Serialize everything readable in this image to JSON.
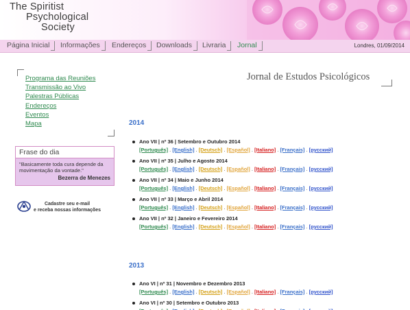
{
  "site": {
    "title_lines": [
      "The Spiritist",
      "Psychological",
      "Society"
    ]
  },
  "nav": {
    "items": [
      {
        "label": "Página Inicial"
      },
      {
        "label": "Informações"
      },
      {
        "label": "Endereços"
      },
      {
        "label": "Downloads"
      },
      {
        "label": "Livraria"
      },
      {
        "label": "Jornal"
      }
    ],
    "date": "Londres, 01/09/2014"
  },
  "left_links": [
    "Programa das Reuniões",
    "Transmissão ao Vivo",
    "Palestras Públicas",
    "Endereços",
    "Eventos",
    "Mapa"
  ],
  "quote": {
    "heading": "Frase do dia",
    "text": "\"Basicamente toda cura depende da movimentação da vontade.\"",
    "author": "Bezerra de Menezes"
  },
  "newsletter": {
    "line1": "Cadastre seu e-mail",
    "line2": "e receba nossas informações"
  },
  "journal_title": "Jornal de Estudos Psicológicos",
  "languages": [
    "[Português]",
    "[English]",
    "[Deutsch]",
    "[Español]",
    "[Italiano]",
    "[Français]",
    "[русский]"
  ],
  "lang_separator": ".",
  "years": [
    {
      "year": "2014",
      "issues": [
        "Ano VII | nº 36 | Setembro e Outubro 2014",
        "Ano VII  | nº 35 | Julho e Agosto  2014",
        " Ano VII | nº 34 | Maio e Junho  2014",
        "Ano VII | nº 33 | Março e Abril  2014",
        " Ano VII | nº 32 | Janeiro e Fevereiro  2014"
      ]
    },
    {
      "year": "2013",
      "issues": [
        "Ano VI | nº 31 | Novembro e Dezembro 2013",
        "Ano VI | nº 30 | Setembro e Outubro 2013"
      ]
    }
  ]
}
